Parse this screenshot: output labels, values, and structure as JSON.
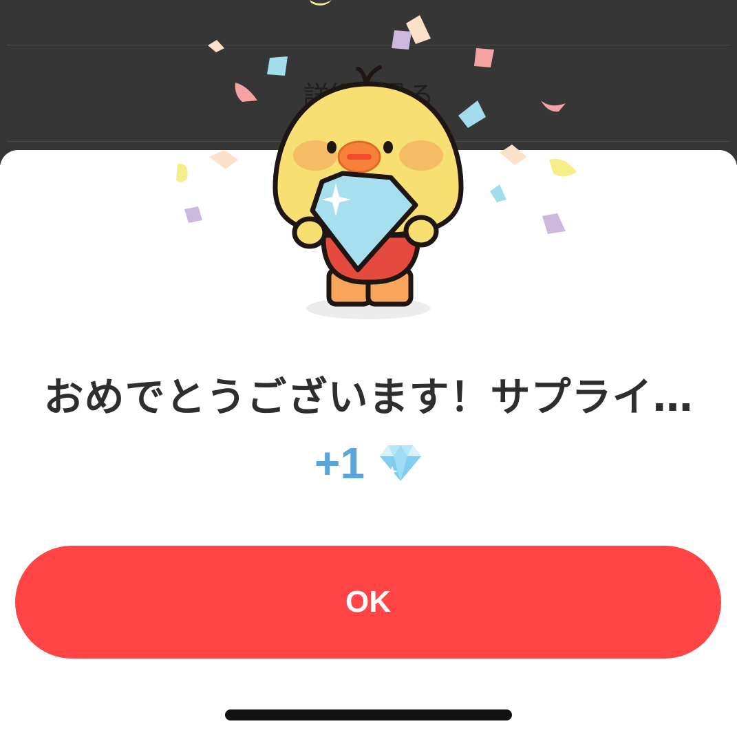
{
  "background_page": {
    "link_label": "詳細を見る"
  },
  "dialog": {
    "title": "おめでとうございます！サプライ…",
    "reward_amount": "+1",
    "reward_icon": "diamond-gem-icon",
    "ok_label": "OK"
  },
  "mascot": {
    "description_icon": "chick-holding-diamond"
  },
  "colors": {
    "accent_red": "#ff4545",
    "reward_blue": "#5aa6dc",
    "backdrop": "#363636"
  }
}
